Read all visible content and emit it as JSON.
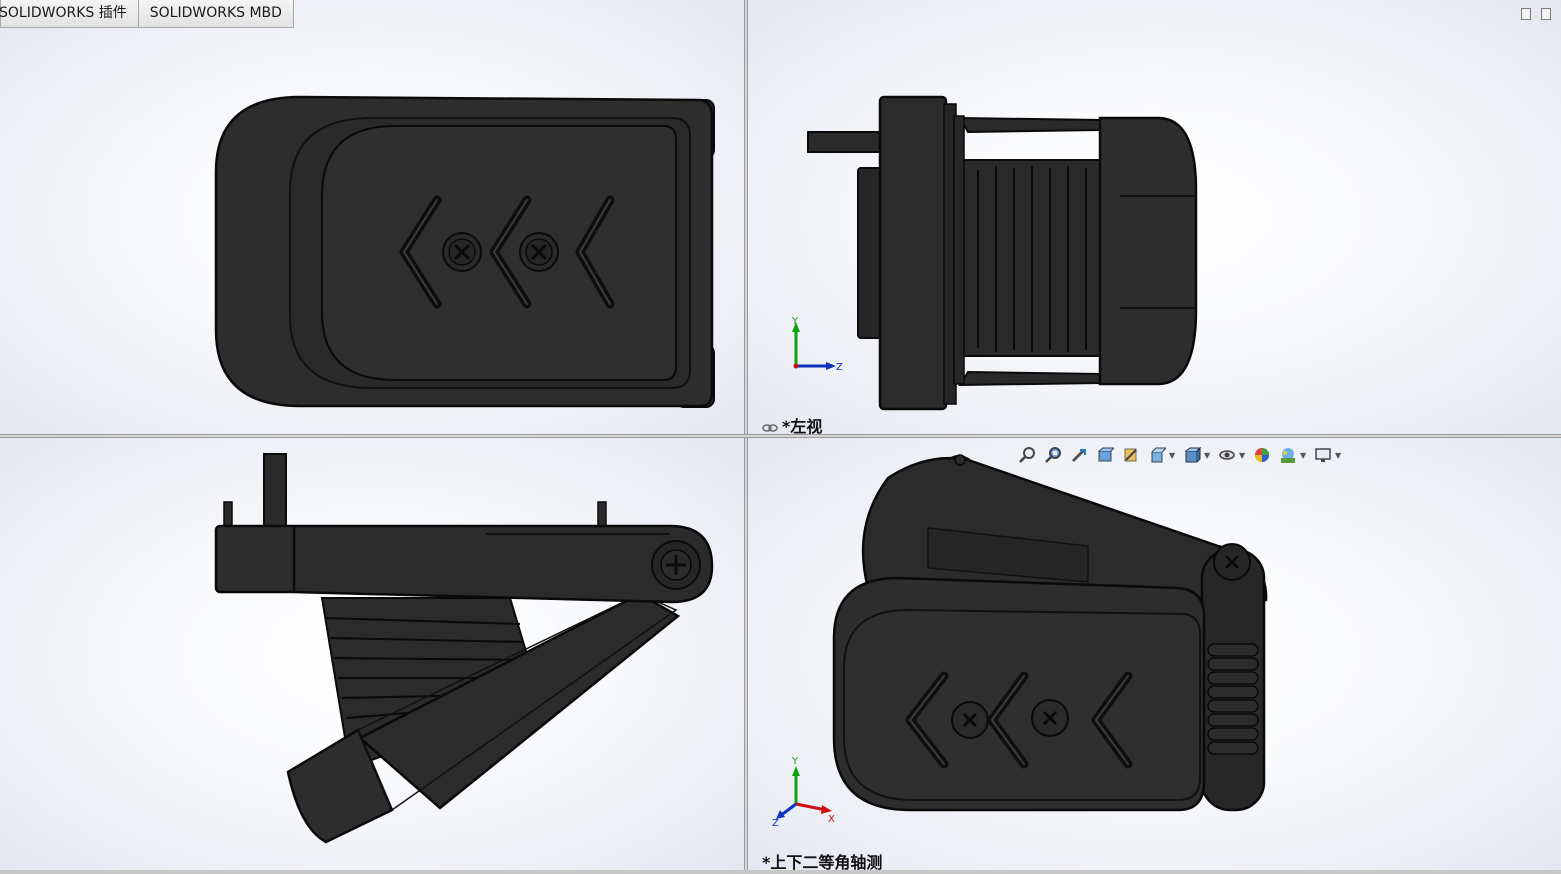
{
  "command_tabs": [
    {
      "label": "SOLIDWORKS 插件"
    },
    {
      "label": "SOLIDWORKS MBD"
    }
  ],
  "viewports": {
    "top_left": {
      "label": ""
    },
    "top_right": {
      "label": "*左视"
    },
    "bottom_left": {
      "label": ""
    },
    "bottom_right": {
      "label": "*上下二等角轴测"
    }
  },
  "triad": {
    "x": "X",
    "y": "Y",
    "z": "Z"
  },
  "heads_up_toolbar": [
    {
      "icon": "zoom-to-fit-icon"
    },
    {
      "icon": "zoom-to-area-icon"
    },
    {
      "icon": "previous-view-icon"
    },
    {
      "icon": "section-view-icon"
    },
    {
      "icon": "dynamic-annotation-icon"
    },
    {
      "icon": "view-orientation-icon",
      "dropdown": true
    },
    {
      "icon": "display-style-icon",
      "dropdown": true
    },
    {
      "icon": "hide-show-items-icon",
      "dropdown": true
    },
    {
      "icon": "edit-appearance-icon"
    },
    {
      "icon": "apply-scene-icon",
      "dropdown": true
    },
    {
      "icon": "view-settings-icon",
      "dropdown": true
    }
  ],
  "colors": {
    "model_body": "#2b2b2b",
    "model_edge": "#0c0c0c",
    "viewport_bg": "#e6eaf0",
    "axis_x": "#d01010",
    "axis_y": "#10a010",
    "axis_z": "#1030c0"
  }
}
